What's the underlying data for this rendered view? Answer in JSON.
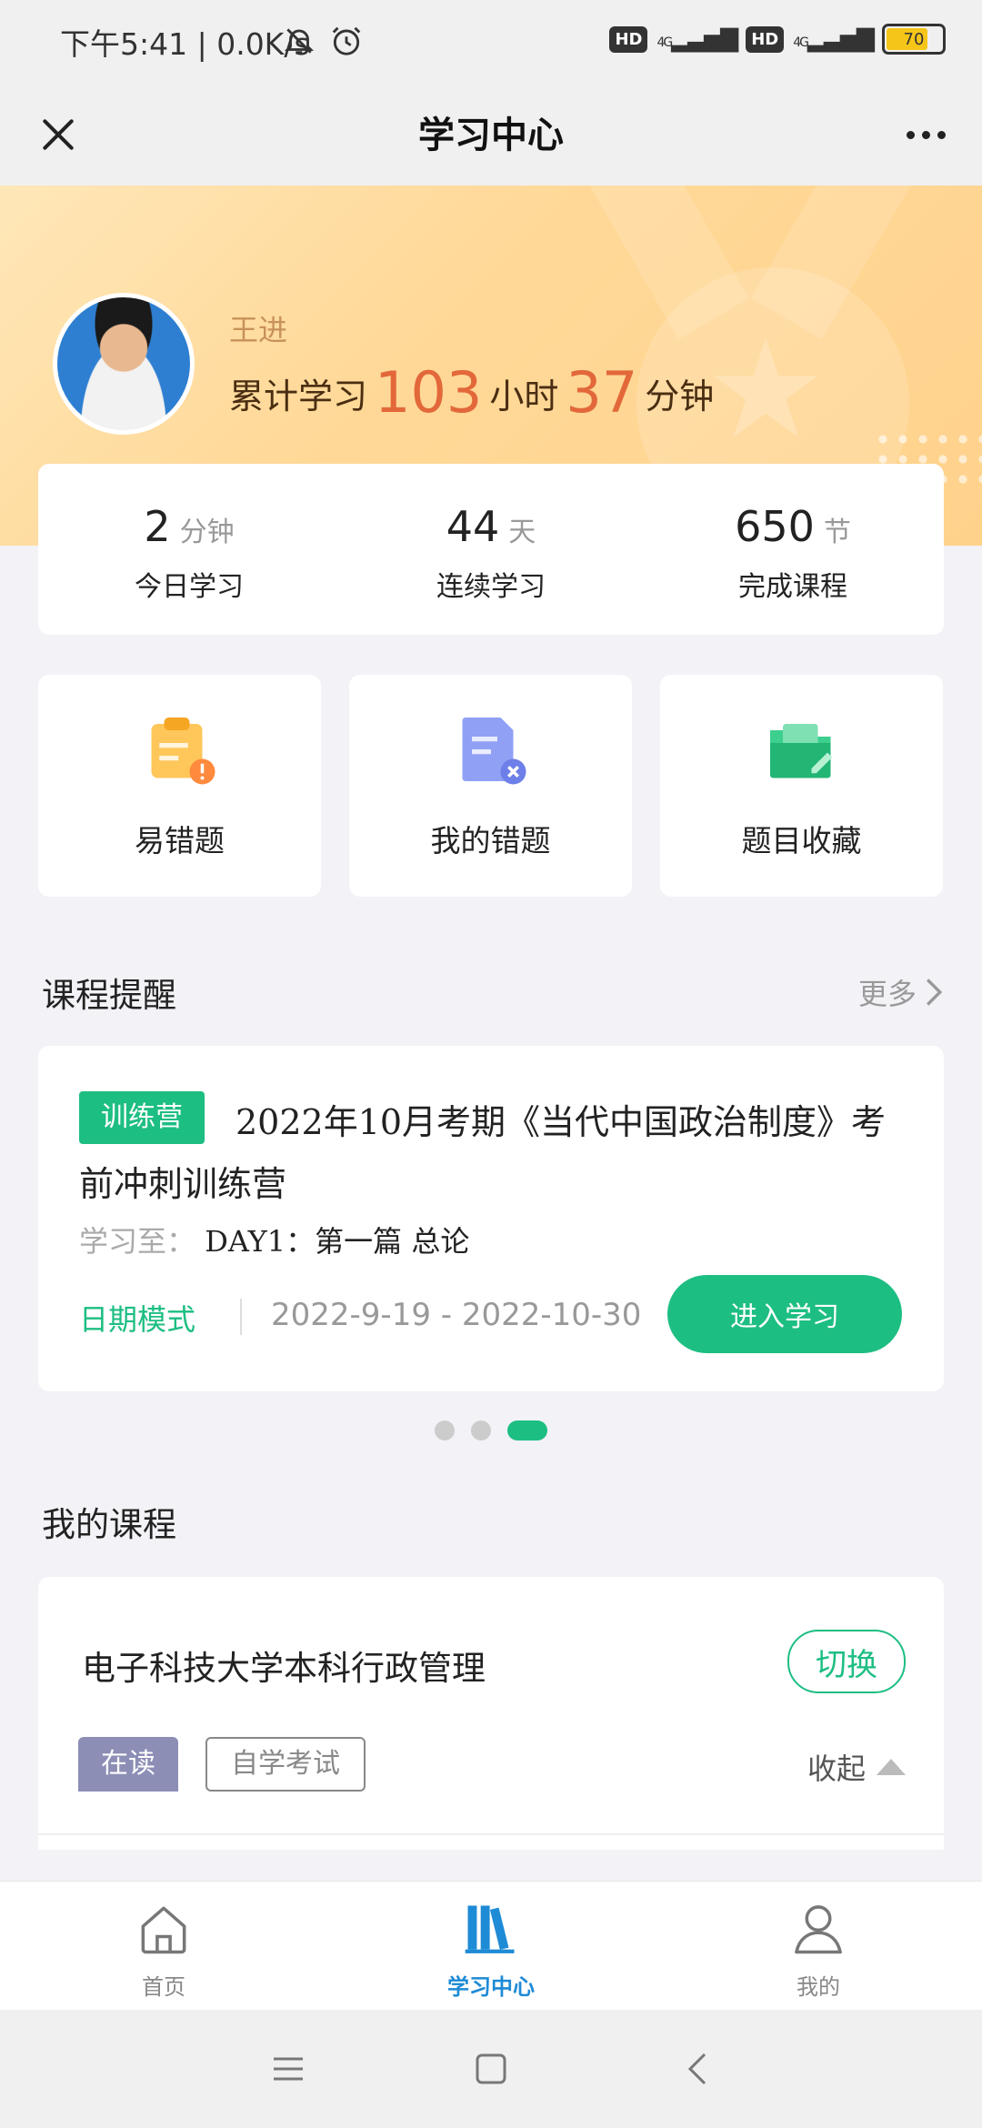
{
  "status_bar": {
    "time_speed": "下午5:41 | 0.0K/s",
    "hd1": "HD",
    "hd2": "HD",
    "net1": "4G",
    "net2": "4G",
    "battery": "70",
    "icons": [
      "mute-bell-icon",
      "alarm-icon",
      "signal-icon",
      "battery-icon"
    ]
  },
  "header": {
    "title": "学习中心",
    "close_icon": "close-icon",
    "more_icon": "more-dots-icon"
  },
  "profile": {
    "name": "王进",
    "total_prefix": "累计学习",
    "total_hours": "103",
    "hours_unit": "小时",
    "total_minutes": "37",
    "minutes_unit": "分钟"
  },
  "stats": [
    {
      "value": "2",
      "unit": "分钟",
      "label": "今日学习"
    },
    {
      "value": "44",
      "unit": "天",
      "label": "连续学习"
    },
    {
      "value": "650",
      "unit": "节",
      "label": "完成课程"
    }
  ],
  "features": [
    {
      "label": "易错题",
      "icon": "clipboard-warning-icon"
    },
    {
      "label": "我的错题",
      "icon": "document-error-icon"
    },
    {
      "label": "题目收藏",
      "icon": "folder-favorite-icon"
    }
  ],
  "reminder": {
    "section_title": "课程提醒",
    "more": "更多",
    "badge": "训练营",
    "course_title": "2022年10月考期《当代中国政治制度》考前冲刺训练营",
    "learn_to_key": "学习至：",
    "learn_to_value": "DAY1：第一篇 总论",
    "date_mode": "日期模式",
    "date_range": "2022-9-19 - 2022-10-30",
    "enter_button": "进入学习",
    "pager_total": 3,
    "pager_active": 3
  },
  "my_courses": {
    "section_title": "我的课程",
    "school": "电子科技大学本科行政管理",
    "switch_button": "切换",
    "reading_tag": "在读",
    "exam_tag": "自学考试",
    "collapse": "收起"
  },
  "tab_bar": {
    "items": [
      {
        "label": "首页",
        "icon": "home-icon",
        "active": false
      },
      {
        "label": "学习中心",
        "icon": "books-icon",
        "active": true
      },
      {
        "label": "我的",
        "icon": "user-icon",
        "active": false
      }
    ]
  },
  "colors": {
    "accent_green": "#1dbe82",
    "accent_blue": "#1e8bd6",
    "highlight_orange": "#e2683a"
  }
}
